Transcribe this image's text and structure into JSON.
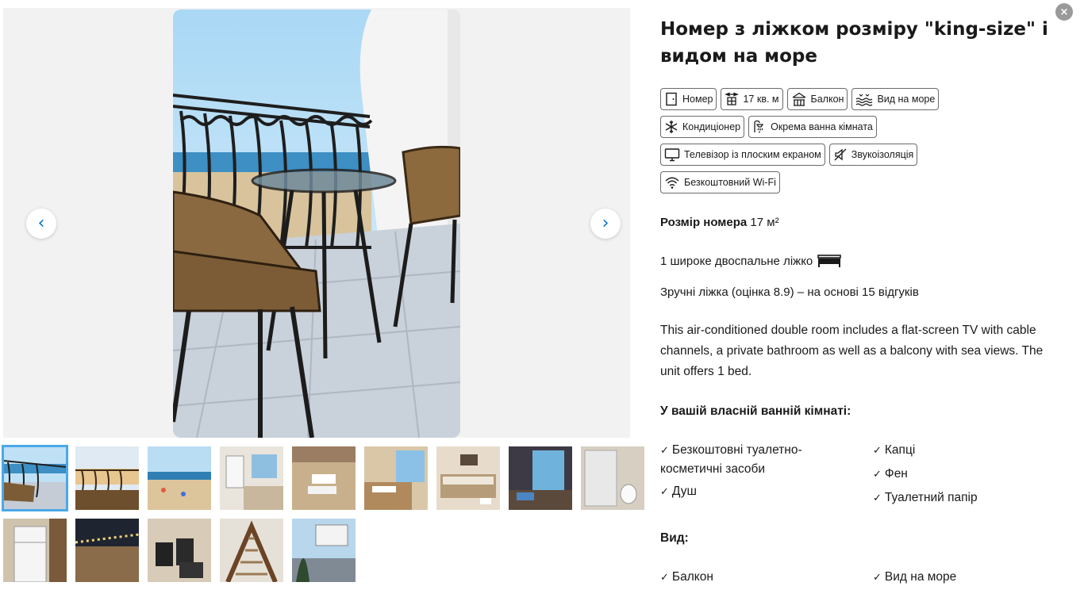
{
  "gallery": {
    "prev_label": "‹",
    "next_label": "›"
  },
  "details": {
    "title": "Номер з ліжком розміру \"king-size\" і видом на море",
    "close_label": "×",
    "badges": [
      {
        "label": "Номер",
        "icon": "room-icon"
      },
      {
        "label": "17 кв. м",
        "icon": "size-icon"
      },
      {
        "label": "Балкон",
        "icon": "balcony-icon"
      },
      {
        "label": "Вид на море",
        "icon": "sea-view-icon"
      },
      {
        "label": "Кондиціонер",
        "icon": "snowflake-icon"
      },
      {
        "label": "Окрема ванна кімната",
        "icon": "shower-icon"
      },
      {
        "label": "Телевізор із плоским екраном",
        "icon": "tv-icon"
      },
      {
        "label": "Звукоізоляція",
        "icon": "soundproof-icon"
      },
      {
        "label": "Безкоштовний Wi-Fi",
        "icon": "wifi-icon"
      }
    ],
    "size_label": "Розмір номера",
    "size_value": "17 м²",
    "bed_text": "1 широке двоспальне ліжко",
    "rating_text": "Зручні ліжка (оцінка 8.9) – на основі 15 відгуків",
    "description": "This air-conditioned double room includes a flat-screen TV with cable channels, a private bathroom as well as a balcony with sea views. The unit offers 1 bed.",
    "bathroom_title": "У вашій власній ванній кімнаті:",
    "bathroom_left": [
      "Безкоштовні туалетно-косметичні засоби",
      "Душ"
    ],
    "bathroom_right": [
      "Капці",
      "Фен",
      "Туалетний папір"
    ],
    "view_title": "Вид:",
    "view_left": [
      "Балкон"
    ],
    "view_right": [
      "Вид на море"
    ],
    "check_mark": "✓"
  }
}
